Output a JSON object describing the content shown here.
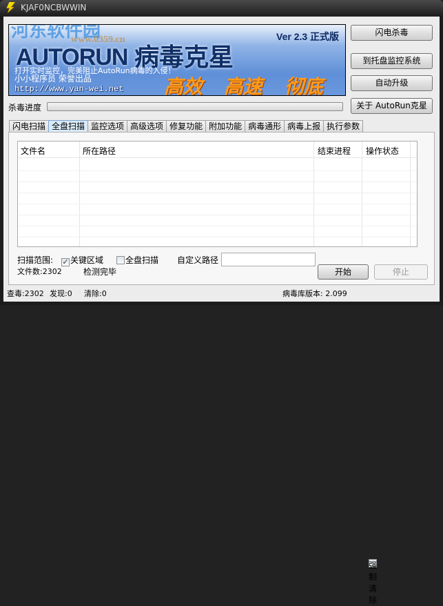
{
  "window": {
    "title": "KJAF0NCBWWIN"
  },
  "watermark": {
    "text": "河东软件园",
    "url": "www.0359.cn"
  },
  "banner": {
    "logo": "AUTORUN",
    "logo_cn": "病毒克星",
    "version": "Ver 2.3 正式版",
    "slogan": "打开实时监控，完美阻止AutoRun病毒的入侵！",
    "author": "小小程序员 荣誉出品",
    "url": "http://www.yan-wei.net",
    "taglines": [
      "高效",
      "高速",
      "彻底"
    ]
  },
  "side_buttons": [
    "闪电杀毒",
    "到托盘监控系统",
    "自动升级",
    "关于 AutoRun克星"
  ],
  "progress": {
    "label": "杀毒进度",
    "value": 0
  },
  "tabs": [
    "闪电扫描",
    "全盘扫描",
    "监控选项",
    "高级选项",
    "修复功能",
    "附加功能",
    "病毒通形",
    "病毒上报",
    "执行参数"
  ],
  "active_tab": 1,
  "list": {
    "columns": [
      "文件名",
      "所在路径",
      "结束进程",
      "操作状态"
    ],
    "rows": []
  },
  "scan": {
    "range_label": "扫描范围:",
    "key_area": "关键区域",
    "key_area_checked": true,
    "full_disk": "全盘扫描",
    "full_disk_checked": false,
    "custom_path_label": "自定义路径",
    "custom_path_value": "",
    "file_count": "文件数:2302",
    "state": "检测完毕",
    "start": "开始",
    "stop": "停止"
  },
  "status": {
    "checked": "查毒:2302",
    "found": "发现:0",
    "cleaned": "清除:0",
    "db_version": "病毒库版本: 2.099",
    "force_clean": "强制清除",
    "force_clean_checked": false
  }
}
